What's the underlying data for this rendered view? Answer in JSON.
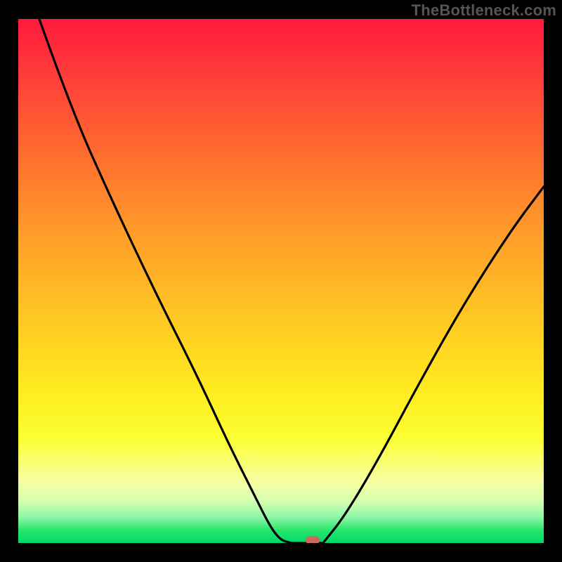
{
  "watermark": "TheBottleneck.com",
  "chart_data": {
    "type": "line",
    "title": "",
    "xlabel": "",
    "ylabel": "",
    "xlim": [
      0,
      100
    ],
    "ylim": [
      0,
      100
    ],
    "grid": false,
    "series": [
      {
        "name": "curve-left",
        "x": [
          4,
          10,
          18,
          26,
          34,
          40,
          45,
          48,
          50,
          52
        ],
        "y": [
          100,
          83,
          65,
          48,
          32,
          19,
          9,
          3,
          0.5,
          0
        ]
      },
      {
        "name": "flat",
        "x": [
          52,
          58
        ],
        "y": [
          0,
          0
        ]
      },
      {
        "name": "curve-right",
        "x": [
          58,
          62,
          68,
          76,
          85,
          94,
          100
        ],
        "y": [
          0,
          5,
          15,
          30,
          46,
          60,
          68
        ]
      }
    ],
    "marker": {
      "x": 56,
      "y": 0.5,
      "color": "#c96a5a"
    },
    "gradient_stops": [
      {
        "pos": 0,
        "color": "#ff1a3c"
      },
      {
        "pos": 50,
        "color": "#ffc224"
      },
      {
        "pos": 80,
        "color": "#fbff30"
      },
      {
        "pos": 100,
        "color": "#00d96a"
      }
    ]
  }
}
